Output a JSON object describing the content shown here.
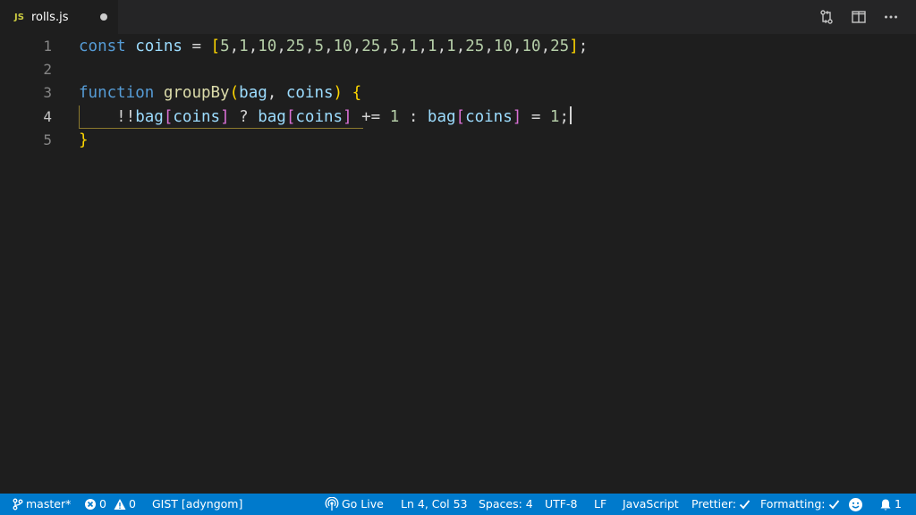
{
  "tab": {
    "icon_label": "JS",
    "file_name": "rolls.js"
  },
  "editor": {
    "line_numbers": [
      "1",
      "2",
      "3",
      "4",
      "5"
    ],
    "current_line": 4,
    "lines": [
      [
        {
          "t": "const",
          "c": "kw"
        },
        {
          "t": " "
        },
        {
          "t": "coins",
          "c": "var"
        },
        {
          "t": " = "
        },
        {
          "t": "[",
          "c": "br-y"
        },
        {
          "t": "5",
          "c": "num"
        },
        {
          "t": ","
        },
        {
          "t": "1",
          "c": "num"
        },
        {
          "t": ","
        },
        {
          "t": "10",
          "c": "num"
        },
        {
          "t": ","
        },
        {
          "t": "25",
          "c": "num"
        },
        {
          "t": ","
        },
        {
          "t": "5",
          "c": "num"
        },
        {
          "t": ","
        },
        {
          "t": "10",
          "c": "num"
        },
        {
          "t": ","
        },
        {
          "t": "25",
          "c": "num"
        },
        {
          "t": ","
        },
        {
          "t": "5",
          "c": "num"
        },
        {
          "t": ","
        },
        {
          "t": "1",
          "c": "num"
        },
        {
          "t": ","
        },
        {
          "t": "1",
          "c": "num"
        },
        {
          "t": ","
        },
        {
          "t": "1",
          "c": "num"
        },
        {
          "t": ","
        },
        {
          "t": "25",
          "c": "num"
        },
        {
          "t": ","
        },
        {
          "t": "10",
          "c": "num"
        },
        {
          "t": ","
        },
        {
          "t": "10",
          "c": "num"
        },
        {
          "t": ","
        },
        {
          "t": "25",
          "c": "num"
        },
        {
          "t": "]",
          "c": "br-y"
        },
        {
          "t": ";"
        }
      ],
      [],
      [
        {
          "t": "function",
          "c": "kw"
        },
        {
          "t": " "
        },
        {
          "t": "groupBy",
          "c": "fn"
        },
        {
          "t": "(",
          "c": "br-y"
        },
        {
          "t": "bag",
          "c": "var"
        },
        {
          "t": ", "
        },
        {
          "t": "coins",
          "c": "var"
        },
        {
          "t": ")",
          "c": "br-y"
        },
        {
          "t": " "
        },
        {
          "t": "{",
          "c": "br-y"
        }
      ],
      [
        {
          "t": "    !!"
        },
        {
          "t": "bag",
          "c": "var"
        },
        {
          "t": "[",
          "c": "br-p"
        },
        {
          "t": "coins",
          "c": "var"
        },
        {
          "t": "]",
          "c": "br-p"
        },
        {
          "t": " ? "
        },
        {
          "t": "bag",
          "c": "var"
        },
        {
          "t": "[",
          "c": "br-p"
        },
        {
          "t": "coins",
          "c": "var"
        },
        {
          "t": "]",
          "c": "br-p"
        },
        {
          "t": " += "
        },
        {
          "t": "1",
          "c": "num"
        },
        {
          "t": " : "
        },
        {
          "t": "bag",
          "c": "var"
        },
        {
          "t": "[",
          "c": "br-p"
        },
        {
          "t": "coins",
          "c": "var"
        },
        {
          "t": "]",
          "c": "br-p"
        },
        {
          "t": " = "
        },
        {
          "t": "1",
          "c": "num"
        },
        {
          "t": ";"
        }
      ],
      [
        {
          "t": "}",
          "c": "br-y"
        }
      ]
    ]
  },
  "statusbar": {
    "branch": "master*",
    "errors": "0",
    "warnings": "0",
    "gist": "GIST [adyngom]",
    "go_live": "Go Live",
    "cursor_position": "Ln 4, Col 53",
    "spaces": "Spaces: 4",
    "encoding": "UTF-8",
    "eol": "LF",
    "language": "JavaScript",
    "prettier": "Prettier:",
    "formatting": "Formatting:",
    "notifications": "1"
  },
  "colors": {
    "statusbar": "#007acc",
    "editor_bg": "#1e1e1e",
    "tabbar_bg": "#252526"
  }
}
